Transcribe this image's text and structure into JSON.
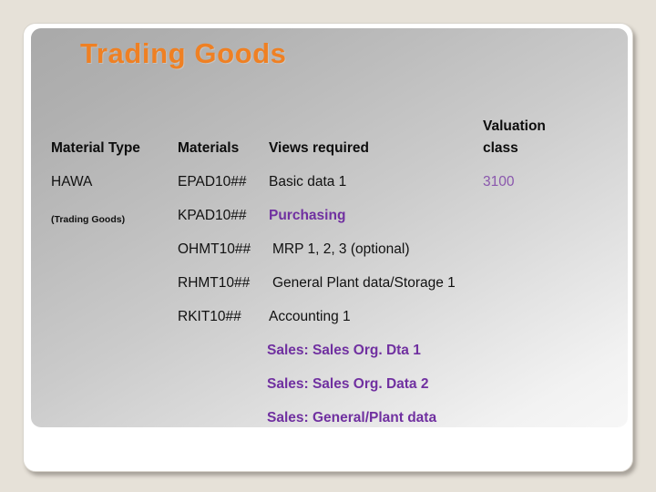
{
  "slide": {
    "title": "Trading Goods",
    "title_color": "#ef8023",
    "accent_purple": "#7030a0",
    "background_color": "#e6e1d8"
  },
  "table": {
    "headers": {
      "material_type": "Material Type",
      "materials": "Materials",
      "views_required": "Views required",
      "valuation_class_line1": "Valuation",
      "valuation_class_line2": "class"
    },
    "material_type": {
      "code": "HAWA",
      "description": "(Trading Goods)"
    },
    "valuation_class_value": "3100",
    "rows": [
      {
        "material": "EPAD10##",
        "view": "Basic data 1",
        "view_style": "normal"
      },
      {
        "material": "KPAD10##",
        "view": "Purchasing",
        "view_style": "purple"
      },
      {
        "material": "OHMT10##",
        "view": "MRP 1, 2, 3 (optional)",
        "view_style": "normal"
      },
      {
        "material": "RHMT10##",
        "view": "General Plant data/Storage 1",
        "view_style": "normal"
      },
      {
        "material": "RKIT10##",
        "view": "Accounting 1",
        "view_style": "normal"
      }
    ],
    "sales_views": [
      "Sales: Sales Org. Dta 1",
      "Sales: Sales Org. Data 2",
      "Sales: General/Plant data"
    ]
  }
}
